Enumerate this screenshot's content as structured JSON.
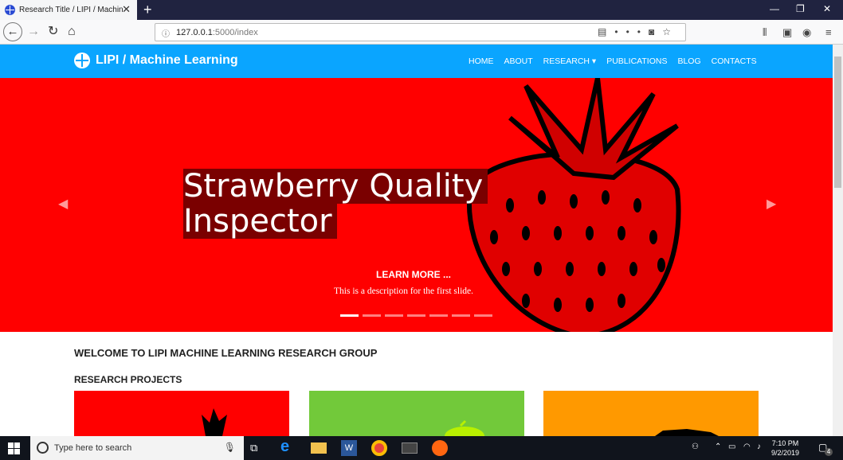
{
  "browser": {
    "tab_title": "Research Title / LIPI / Machine L",
    "url_host": "127.0.0.1",
    "url_path": ":5000/index",
    "dots": "•••"
  },
  "site": {
    "brand": "LIPI / Machine Learning",
    "menu": [
      "HOME",
      "ABOUT",
      "RESEARCH ▾",
      "PUBLICATIONS",
      "BLOG",
      "CONTACTS"
    ]
  },
  "hero": {
    "title_line1": "Strawberry Quality",
    "title_line2": "Inspector",
    "learn_more": "LEARN MORE ...",
    "description": "This is a description for the first slide.",
    "indicator_count": 7,
    "active_indicator": 0
  },
  "content": {
    "welcome": "WELCOME TO LIPI MACHINE LEARNING RESEARCH GROUP",
    "projects_heading": "RESEARCH PROJECTS",
    "card_colors": [
      "#ff0000",
      "#72c93a",
      "#ff9900"
    ]
  },
  "taskbar": {
    "search_placeholder": "Type here to search",
    "time": "7:10 PM",
    "date": "9/2/2019",
    "notifications": "4"
  }
}
